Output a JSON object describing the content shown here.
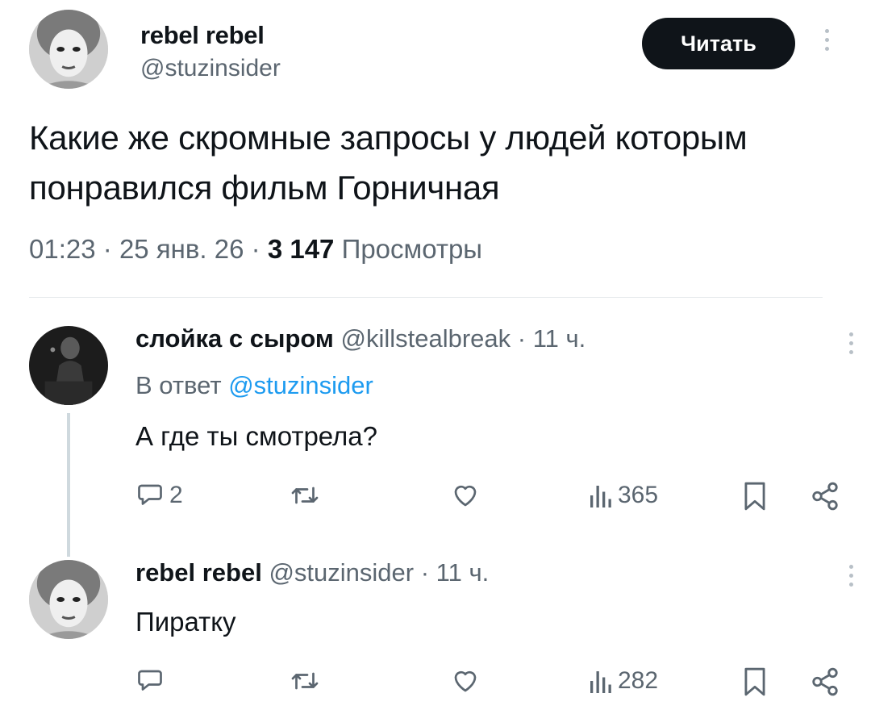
{
  "tweet": {
    "author_name": "rebel rebel",
    "author_handle": "@stuzinsider",
    "follow_label": "Читать",
    "text": "Какие же скромные запросы у людей которым понравился фильм Горничная",
    "time": "01:23",
    "date": "25 янв. 26",
    "views_count": "3 147",
    "views_label": "Просмотры",
    "sep": "·"
  },
  "replies": [
    {
      "author_name": "слойка с сыром",
      "author_handle": "@killstealbreak",
      "age": "11 ч.",
      "reply_prefix": "В ответ",
      "reply_to": "@stuzinsider",
      "text": "А где ты смотрела?",
      "reply_count": "2",
      "views": "365"
    },
    {
      "author_name": "rebel rebel",
      "author_handle": "@stuzinsider",
      "age": "11 ч.",
      "text": "Пиратку",
      "reply_count": "",
      "views": "282"
    }
  ],
  "icons": {
    "reply": "reply-icon",
    "retweet": "retweet-icon",
    "like": "heart-icon",
    "views": "views-icon",
    "bookmark": "bookmark-icon",
    "share": "share-icon",
    "more": "more-vertical-icon"
  },
  "colors": {
    "text": "#0f1419",
    "muted": "#5b6670",
    "link": "#1d9bf0",
    "button_bg": "#0f1419",
    "button_text": "#ffffff"
  }
}
